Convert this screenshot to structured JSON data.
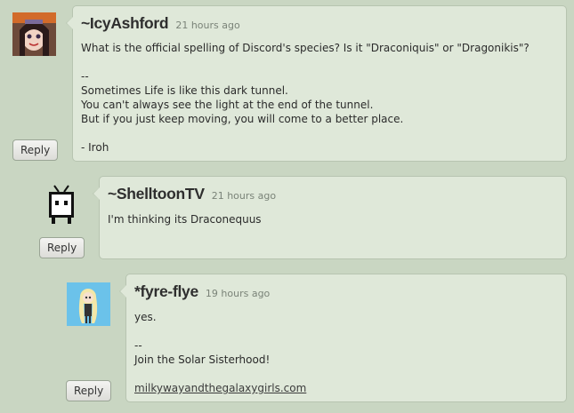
{
  "comments": [
    {
      "username": "~IcyAshford",
      "time": "21 hours ago",
      "body": "What is the official spelling of Discord's species? Is it \"Draconiquis\" or \"Dragonikis\"?\n\n--\nSometimes Life is like this dark tunnel.\nYou can't always see the light at the end of the tunnel.\nBut if you just keep moving, you will come to a better place.\n\n- Iroh",
      "reply_label": "Reply"
    },
    {
      "username": "~ShelltoonTV",
      "time": "21 hours ago",
      "body": "I'm thinking its Draconequus",
      "reply_label": "Reply"
    },
    {
      "username": "*fyre-flye",
      "time": "19 hours ago",
      "body": "yes.\n\n--\nJoin the Solar Sisterhood!\n",
      "link": "milkywayandthegalaxygirls.com",
      "reply_label": "Reply"
    }
  ],
  "colors": {
    "background": "#c9d6c2",
    "card": "#dfe8d9",
    "card_border": "#b7c4b0"
  }
}
